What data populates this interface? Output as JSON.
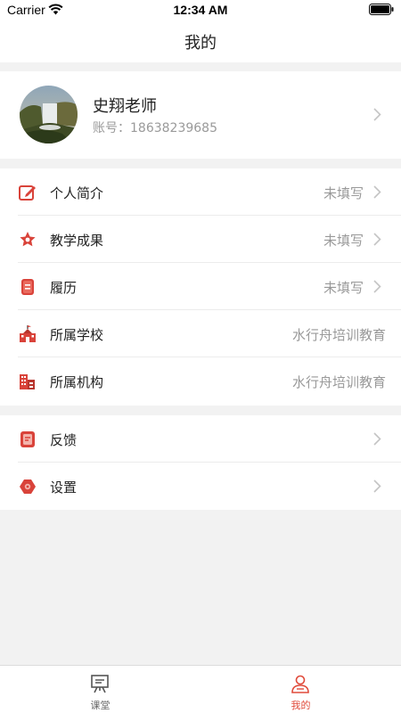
{
  "status_bar": {
    "carrier": "Carrier",
    "time": "12:34 AM"
  },
  "nav": {
    "title": "我的"
  },
  "profile": {
    "name": "史翔老师",
    "account": "账号：18638239685"
  },
  "groups": [
    {
      "items": [
        {
          "label": "个人简介",
          "value": "未填写",
          "icon": "edit-icon",
          "arrow": true
        },
        {
          "label": "教学成果",
          "value": "未填写",
          "icon": "medal-icon",
          "arrow": true
        },
        {
          "label": "履历",
          "value": "未填写",
          "icon": "resume-icon",
          "arrow": true
        },
        {
          "label": "所属学校",
          "value": "水行舟培训教育",
          "icon": "school-icon",
          "arrow": false
        },
        {
          "label": "所属机构",
          "value": "水行舟培训教育",
          "icon": "building-icon",
          "arrow": false
        }
      ]
    },
    {
      "items": [
        {
          "label": "反馈",
          "value": "",
          "icon": "feedback-icon",
          "arrow": true
        },
        {
          "label": "设置",
          "value": "",
          "icon": "settings-icon",
          "arrow": true
        }
      ]
    }
  ],
  "tabs": [
    {
      "label": "课堂",
      "icon": "classroom-icon",
      "active": false
    },
    {
      "label": "我的",
      "icon": "profile-icon",
      "active": true
    }
  ],
  "colors": {
    "accent": "#e04a3a",
    "icon_red": "#d9433a",
    "tab_inactive": "#666666",
    "background": "#f2f2f2"
  }
}
